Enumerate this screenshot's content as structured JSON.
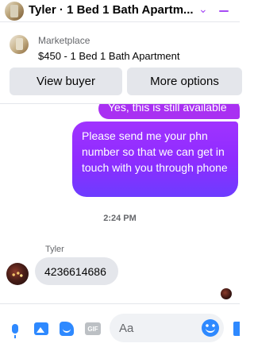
{
  "header": {
    "title": "Tyler · 1 Bed 1 Bath Apartm...",
    "chevron_glyph": "⌄",
    "accent_color": "#a64bf4"
  },
  "marketplace": {
    "label": "Marketplace",
    "listing": "$450 - 1 Bed 1 Bath Apartment",
    "view_buyer_label": "View buyer",
    "more_options_label": "More options"
  },
  "messages": {
    "outgoing_partial": "Yes, this is still available",
    "outgoing_main": "Please send me your phn number so that we can get in touch with you through phone",
    "timestamp": "2:24 PM",
    "sender_name": "Tyler",
    "incoming": "4236614686",
    "outgoing_color": "#9b2ff5",
    "incoming_bg": "#e4e6eb"
  },
  "composer": {
    "placeholder": "Aa",
    "gif_label": "GIF",
    "icon_color": "#2e89ff",
    "icons": [
      "microphone-icon",
      "image-icon",
      "sticker-icon",
      "gif-icon",
      "emoji-icon",
      "thumbs-up-icon"
    ]
  }
}
